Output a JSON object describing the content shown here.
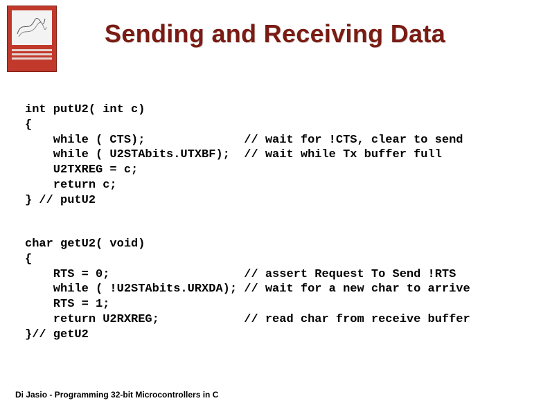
{
  "title": "Sending and Receiving Data",
  "code_block_1": "int putU2( int c)\n{\n    while ( CTS);              // wait for !CTS, clear to send\n    while ( U2STAbits.UTXBF);  // wait while Tx buffer full\n    U2TXREG = c;\n    return c;\n} // putU2",
  "code_block_2": "char getU2( void)\n{\n    RTS = 0;                   // assert Request To Send !RTS\n    while ( !U2STAbits.URXDA); // wait for a new char to arrive\n    RTS = 1;\n    return U2RXREG;            // read char from receive buffer\n}// getU2",
  "footer": "Di Jasio - Programming 32-bit Microcontrollers in C"
}
